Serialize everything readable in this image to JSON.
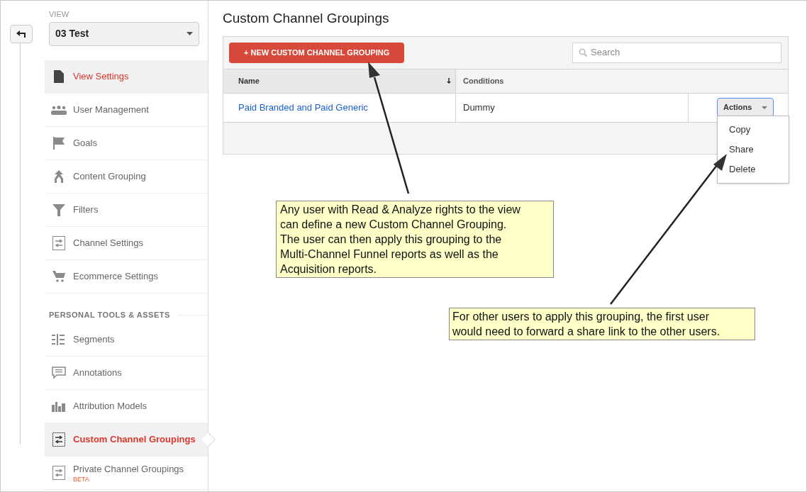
{
  "sidebar": {
    "view_label": "VIEW",
    "view_select": {
      "value": "03 Test"
    },
    "sections": [
      {
        "items": [
          {
            "label": "View Settings",
            "highlighted": true,
            "selected": false
          },
          {
            "label": "User Management",
            "highlighted": false,
            "selected": false
          },
          {
            "label": "Goals",
            "highlighted": false,
            "selected": false
          },
          {
            "label": "Content Grouping",
            "highlighted": false,
            "selected": false
          },
          {
            "label": "Filters",
            "highlighted": false,
            "selected": false
          },
          {
            "label": "Channel Settings",
            "highlighted": false,
            "selected": false
          },
          {
            "label": "Ecommerce Settings",
            "highlighted": false,
            "selected": false
          }
        ]
      },
      {
        "heading": "PERSONAL TOOLS & ASSETS",
        "items": [
          {
            "label": "Segments",
            "highlighted": false,
            "selected": false
          },
          {
            "label": "Annotations",
            "highlighted": false,
            "selected": false
          },
          {
            "label": "Attribution Models",
            "highlighted": false,
            "selected": false
          },
          {
            "label": "Custom Channel Groupings",
            "highlighted": false,
            "selected": true
          },
          {
            "label": "Private Channel Groupings",
            "badge": "BETA",
            "highlighted": false,
            "selected": false
          }
        ]
      }
    ]
  },
  "main": {
    "title": "Custom Channel Groupings",
    "new_button": "+ NEW CUSTOM CHANNEL GROUPING",
    "search": {
      "placeholder": "Search"
    },
    "table": {
      "columns": [
        {
          "label": "Name",
          "sorted": true
        },
        {
          "label": "Conditions",
          "sorted": false
        }
      ],
      "rows": [
        {
          "name": "Paid Branded and Paid Generic",
          "conditions": "Dummy",
          "action_button": "Actions"
        }
      ]
    },
    "actions_menu": {
      "items": [
        "Copy",
        "Share",
        "Delete"
      ]
    }
  },
  "callouts": [
    {
      "text": "Any user with Read & Analyze rights to the view can define a new Custom Channel Grouping. The user can then apply this grouping to the Multi-Channel Funnel reports as well as the Acquisition reports."
    },
    {
      "text": "For other users to apply this grouping, the first user would need to forward a share link to the other users."
    }
  ]
}
